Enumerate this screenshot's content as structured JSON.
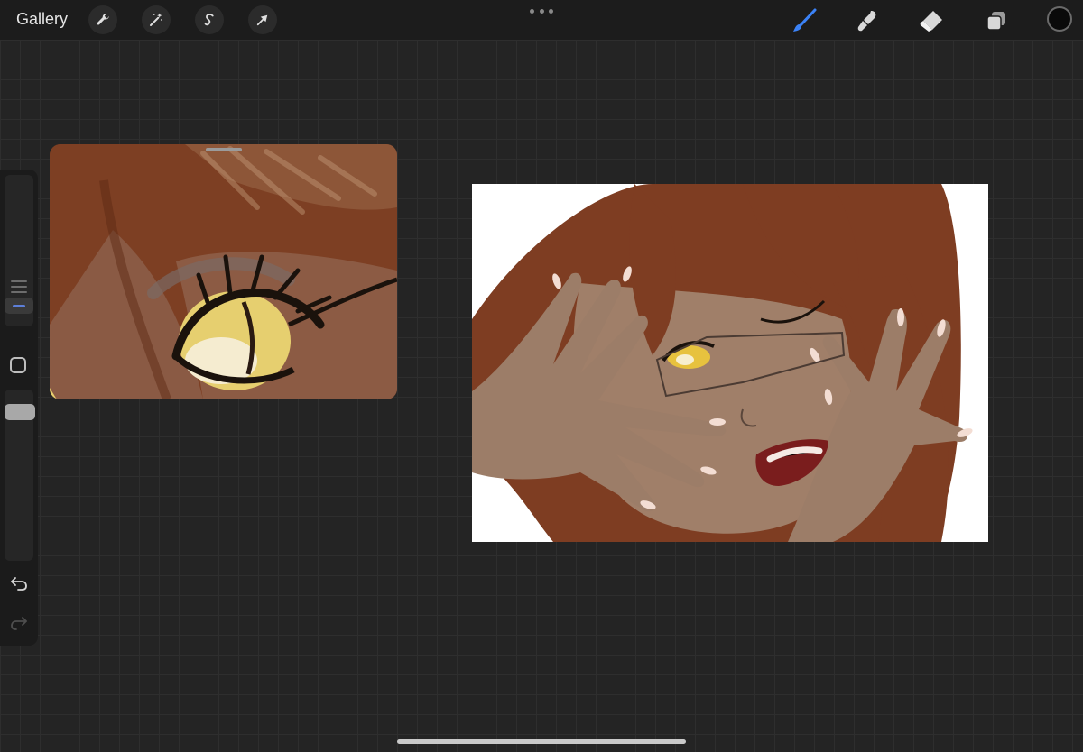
{
  "topbar": {
    "gallery_label": "Gallery",
    "left_tools": [
      "wrench-icon",
      "magic-wand-icon",
      "selection-icon",
      "transform-arrow-icon"
    ],
    "right_tools": [
      "brush-icon",
      "smudge-icon",
      "eraser-icon",
      "layers-icon"
    ],
    "active_tool": "brush-icon",
    "current_color": "#0a0a0a",
    "accent_color": "#3b82f6"
  },
  "sidebar": {
    "items": [
      "brush-size-slider",
      "modify-button",
      "opacity-slider",
      "undo-icon",
      "redo-icon"
    ]
  },
  "reference_window": {
    "visible": true
  },
  "canvas": {
    "background": "#ffffff"
  }
}
